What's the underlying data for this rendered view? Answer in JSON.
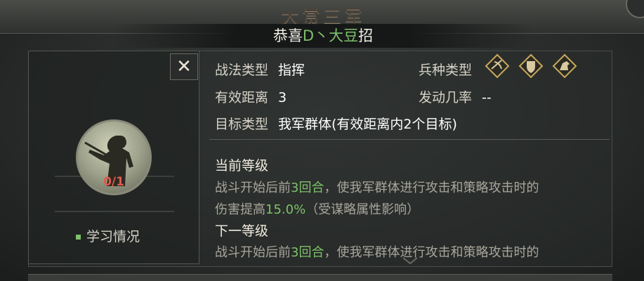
{
  "header": {
    "title": "大赏三军"
  },
  "notice": {
    "prefix": "恭喜",
    "name": "D丶大豆",
    "suffix": "招"
  },
  "skill": {
    "type_label": "战法类型",
    "type_value": "指挥",
    "range_label": "有效距离",
    "range_value": "3",
    "target_label": "目标类型",
    "target_value": "我军群体(有效距离内2个目标)",
    "troop_label": "兵种类型",
    "chance_label": "发动几率",
    "chance_value": "--"
  },
  "portrait": {
    "level": "0/1"
  },
  "study": {
    "label": "学习情况"
  },
  "current": {
    "title": "当前等级",
    "line1_a": "战斗开始后前",
    "line1_hl": "3回合",
    "line1_b": "，使我军群体进行攻击和策略攻击时的",
    "line2_a": "伤害提高",
    "line2_hl": "15.0%",
    "line2_b": "（受谋略属性影响）"
  },
  "next": {
    "title": "下一等级",
    "line1_a": "战斗开始后前",
    "line1_hl": "3回合",
    "line1_b": "，使我军群体进行攻击和策略攻击时的"
  },
  "close": {
    "label": "✕"
  },
  "icons": {
    "troop1": "crossbow-troop-icon",
    "troop2": "shield-troop-icon",
    "troop3": "cavalry-troop-icon"
  },
  "colors": {
    "highlight": "#7fc06a",
    "level": "#e05a4a"
  }
}
